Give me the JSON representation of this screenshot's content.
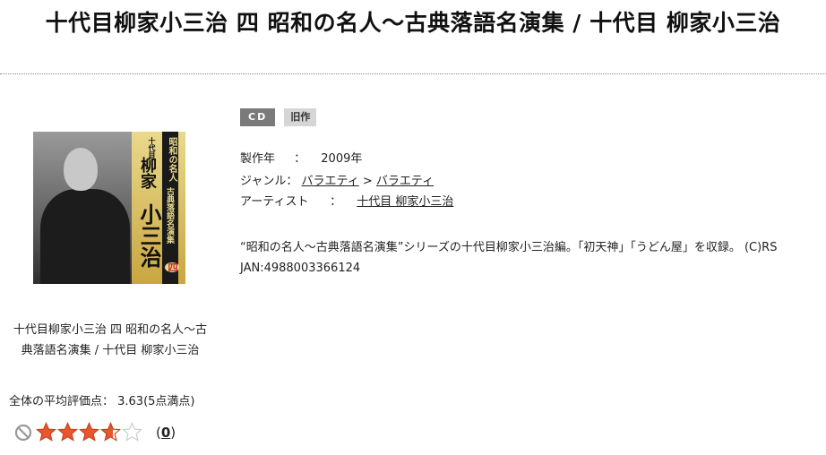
{
  "page_title": "十代目柳家小三治 四 昭和の名人～古典落語名演集 / 十代目 柳家小三治",
  "cover": {
    "texts": [
      "昭和の名人",
      "古典落語名演集",
      "十代目",
      "柳家",
      "小三治",
      "四"
    ]
  },
  "badges": {
    "format": "CD",
    "status": "旧作"
  },
  "meta": {
    "year_label": "製作年",
    "year_sep": "：",
    "year_value": "2009年",
    "genre_label": "ジャンル：",
    "genre_1": "バラエティ",
    "genre_sep": ">",
    "genre_2": "バラエティ",
    "artist_label": "アーティスト",
    "artist_sep": "：",
    "artist_value": "十代目 柳家小三治"
  },
  "description": {
    "line1": "“昭和の名人～古典落語名演集”シリーズの十代目柳家小三治編。「初天神」「うどん屋」を収録。 (C)RS",
    "line2": "JAN:4988003366124"
  },
  "caption": {
    "line1": "十代目柳家小三治 四 昭和の名人～古",
    "line2": "典落語名演集 / 十代目 柳家小三治"
  },
  "rating": {
    "avg_text": "全体の平均評価点： 3.63(5点満点)",
    "stars_value": 3.63,
    "stars_max": 5,
    "open_paren": "(",
    "count": "0",
    "close_paren": ")"
  },
  "colors": {
    "star_fill": "#e8562f",
    "star_empty": "#cccccc",
    "badge_cd": "#7a7a7a",
    "badge_old": "#d6d6d6"
  },
  "icons": {
    "clear_rating": "no-entry-icon",
    "star": "star-icon"
  }
}
